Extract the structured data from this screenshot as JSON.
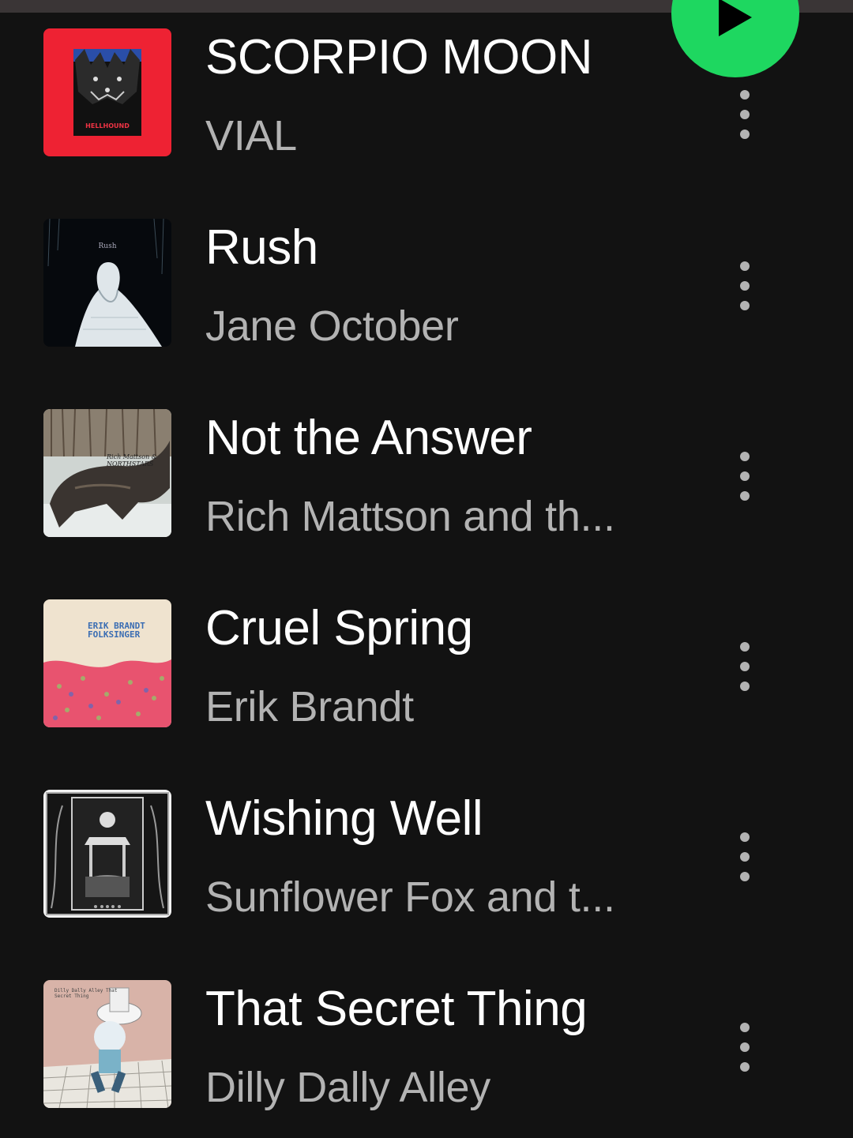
{
  "play_button_label": "Play",
  "tracks": [
    {
      "title": "SCORPIO MOON",
      "artist": "VIAL",
      "art_text": "HELLHOUND"
    },
    {
      "title": "Rush",
      "artist": "Jane October",
      "art_text": "Rush"
    },
    {
      "title": "Not the Answer",
      "artist": "Rich Mattson and th...",
      "art_text": "Rich Mattson & NORTHSTARS"
    },
    {
      "title": "Cruel Spring",
      "artist": "Erik Brandt",
      "art_text": "ERIK BRANDT FOLKSINGER"
    },
    {
      "title": "Wishing Well",
      "artist": "Sunflower Fox and t...",
      "art_text": ""
    },
    {
      "title": "That Secret Thing",
      "artist": "Dilly Dally Alley",
      "art_text": "Dilly Dally Alley That Secret Thing"
    }
  ],
  "icons": {
    "play": "play-icon",
    "more": "more-options-icon"
  },
  "colors": {
    "background": "#121212",
    "accent": "#1ed760",
    "title": "#ffffff",
    "subtitle": "#b3b3b3"
  }
}
